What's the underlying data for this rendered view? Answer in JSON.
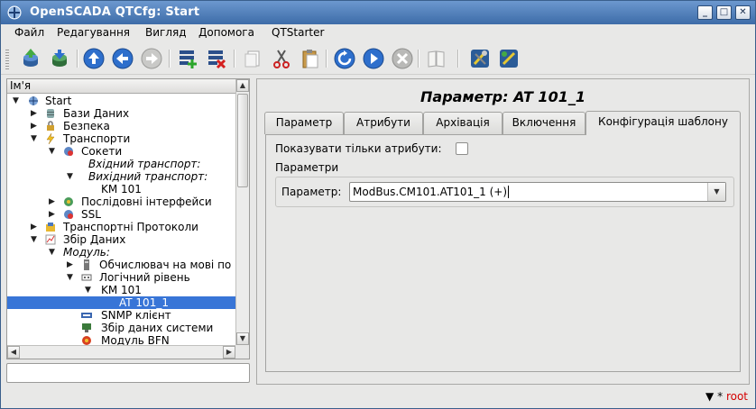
{
  "window": {
    "title": "OpenSCADA QTCfg: Start"
  },
  "menu": [
    "Файл",
    "Редагування",
    "Вигляд",
    "Допомога",
    "QTStarter"
  ],
  "toolbar": {
    "icons": [
      "db-load-icon",
      "db-save-icon",
      "up-icon",
      "back-icon",
      "forward-icon",
      "add-item-icon",
      "delete-item-icon",
      "copy-icon",
      "cut-icon",
      "paste-icon",
      "refresh-icon",
      "start-icon",
      "stop-icon",
      "manual-icon",
      "module-info-icon",
      "module-config-icon"
    ]
  },
  "tree": {
    "header": "Ім'я",
    "rows": [
      {
        "label": "Start",
        "italic": false,
        "selected": false
      },
      {
        "label": "Бази Даних",
        "italic": false,
        "selected": false
      },
      {
        "label": "Безпека",
        "italic": false,
        "selected": false
      },
      {
        "label": "Транспорти",
        "italic": false,
        "selected": false
      },
      {
        "label": "Сокети",
        "italic": false,
        "selected": false
      },
      {
        "label": "Вхідний транспорт:",
        "italic": true,
        "selected": false
      },
      {
        "label": "Вихідний транспорт:",
        "italic": true,
        "selected": false
      },
      {
        "label": "KM 101",
        "italic": false,
        "selected": false
      },
      {
        "label": "Послідовні інтерфейси",
        "italic": false,
        "selected": false
      },
      {
        "label": "SSL",
        "italic": false,
        "selected": false
      },
      {
        "label": "Транспортні Протоколи",
        "italic": false,
        "selected": false
      },
      {
        "label": "Збір Даних",
        "italic": false,
        "selected": false
      },
      {
        "label": "Модуль:",
        "italic": true,
        "selected": false
      },
      {
        "label": "Обчислювач на мові по",
        "italic": false,
        "selected": false
      },
      {
        "label": "Логічний рівень",
        "italic": false,
        "selected": false
      },
      {
        "label": "KM 101",
        "italic": false,
        "selected": false
      },
      {
        "label": "AT 101_1",
        "italic": false,
        "selected": true
      },
      {
        "label": "SNMP клієнт",
        "italic": false,
        "selected": false
      },
      {
        "label": "Збір даних системи",
        "italic": false,
        "selected": false
      },
      {
        "label": "Модуль BFN",
        "italic": false,
        "selected": false
      }
    ]
  },
  "page": {
    "title": "Параметр: AT 101_1",
    "tabs": [
      "Параметр",
      "Атрибути",
      "Архівація",
      "Включення",
      "Конфігурація шаблону"
    ],
    "active_tab": "Конфігурація шаблону",
    "show_attrs_label": "Показувати тільки атрибути:",
    "show_attrs_checked": false,
    "params_label": "Параметри",
    "param_field_label": "Параметр:",
    "param_field_value": "ModBus.CM101.AT101_1 (+)"
  },
  "status": {
    "marker": "*",
    "user": "root"
  }
}
